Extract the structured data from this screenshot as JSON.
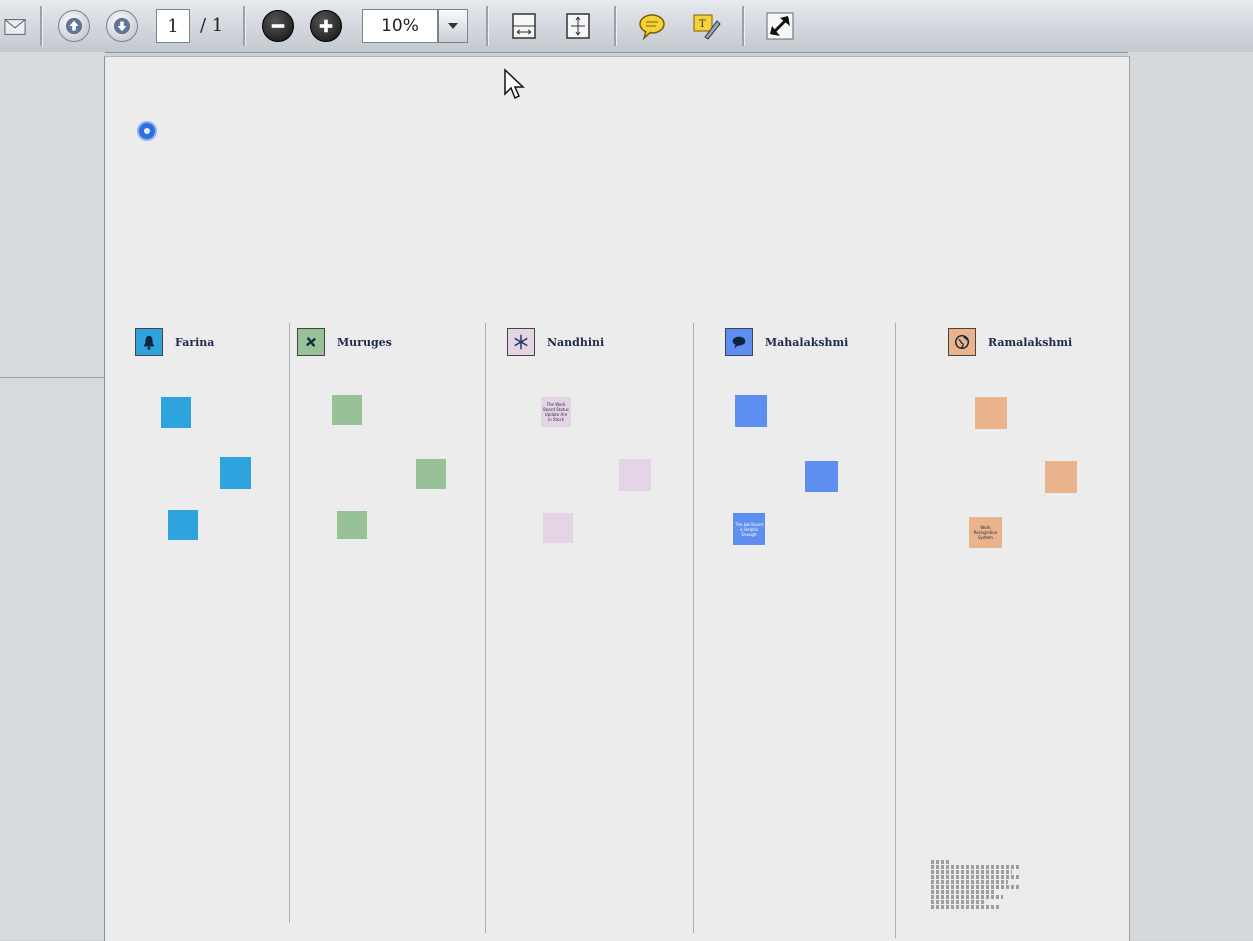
{
  "toolbar": {
    "page_current": "1",
    "page_total": "/ 1",
    "zoom": "10%",
    "icons": [
      "mail-icon",
      "page-up-icon",
      "page-down-icon",
      "zoom-out-icon",
      "zoom-in-icon",
      "zoom-dropdown-icon",
      "fit-width-icon",
      "fit-page-icon",
      "comment-icon",
      "highlight-icon",
      "fullscreen-icon"
    ]
  },
  "lanes": [
    {
      "name": "Farina",
      "color": "#2ea3dd",
      "icon": "bell-icon"
    },
    {
      "name": "Muruges",
      "color": "#98c198",
      "icon": "fan-icon"
    },
    {
      "name": "Nandhini",
      "color": "#e5d3e6",
      "icon": "snowflake-icon"
    },
    {
      "name": "Mahalakshmi",
      "color": "#5d8ef0",
      "icon": "speech-bubble-icon"
    },
    {
      "name": "Ramalakshmi",
      "color": "#e9b38c",
      "icon": "globe-icon"
    }
  ],
  "notes": {
    "ramalakshmi_3": "Work Recognition System",
    "mahalakshmi_3": "The Job Board is Helpful Enough",
    "nandhini_1": "The Work Board Status Update Are in Stock"
  }
}
